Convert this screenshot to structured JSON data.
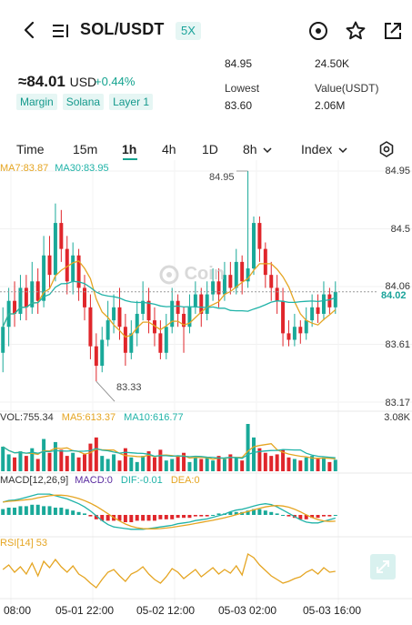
{
  "header": {
    "pair": "SOL/USDT",
    "leverage": "5X",
    "icons": [
      "back-icon",
      "list-icon",
      "target-icon",
      "star-icon",
      "share-icon"
    ]
  },
  "summary": {
    "price": "≈84.01",
    "price_unit": "USD",
    "change": "+0.44%",
    "tags": [
      "Margin",
      "Solana",
      "Layer 1"
    ],
    "high_value": "84.95",
    "vol_value": "24.50K",
    "lowest_label": "Lowest",
    "lowest_value": "83.60",
    "value_label": "Value(USDT)",
    "value_value": "2.06M"
  },
  "tabs": {
    "time": "Time",
    "m15": "15m",
    "h1": "1h",
    "h4": "4h",
    "d1": "1D",
    "h8": "8h",
    "index": "Index",
    "active": "1h"
  },
  "legend": {
    "ma7": "MA7:83.87",
    "ma30": "MA30:83.95",
    "vol": "VOL:755.34",
    "ma5": "MA5:613.37",
    "ma10": "MA10:616.77",
    "macd_params": "MACD[12,26,9]",
    "macd": "MACD:0",
    "dif": "DIF:-0.01",
    "dea": "DEA:0",
    "rsi": "RSI[14] 53"
  },
  "axis": {
    "p1": "84.95",
    "p2": "84.5",
    "p3": "84.06",
    "p4": "83.61",
    "p5": "83.17",
    "vol_max": "3.08K",
    "current": "84.02",
    "high_marker": "84.95",
    "low_marker": "83.33",
    "x": [
      "08:00",
      "05-01 22:00",
      "05-02 12:00",
      "05-03 02:00",
      "05-03 16:00"
    ]
  },
  "watermark": "Coin",
  "colors": {
    "up": "#19a999",
    "down": "#e0262b",
    "ma7": "#e5a522",
    "ma30": "#20b3a8",
    "macd_dif": "#20b3a8",
    "rsi": "#e5a522"
  },
  "chart_data": {
    "type": "candlestick",
    "timeframe": "1h",
    "y_range": [
      83.17,
      84.95
    ],
    "candles": [
      {
        "o": 83.55,
        "c": 83.75,
        "h": 83.9,
        "l": 83.4
      },
      {
        "o": 83.75,
        "c": 83.95,
        "h": 84.05,
        "l": 83.6
      },
      {
        "o": 83.95,
        "c": 83.85,
        "h": 84.1,
        "l": 83.75
      },
      {
        "o": 83.85,
        "c": 84.05,
        "h": 84.15,
        "l": 83.8
      },
      {
        "o": 84.05,
        "c": 83.9,
        "h": 84.15,
        "l": 83.8
      },
      {
        "o": 83.9,
        "c": 84.1,
        "h": 84.25,
        "l": 83.85
      },
      {
        "o": 84.1,
        "c": 83.95,
        "h": 84.2,
        "l": 83.85
      },
      {
        "o": 83.95,
        "c": 84.3,
        "h": 84.45,
        "l": 83.9
      },
      {
        "o": 84.3,
        "c": 84.15,
        "h": 84.45,
        "l": 84.05
      },
      {
        "o": 84.15,
        "c": 84.55,
        "h": 84.7,
        "l": 84.1
      },
      {
        "o": 84.55,
        "c": 84.35,
        "h": 84.65,
        "l": 84.25
      },
      {
        "o": 84.35,
        "c": 84.1,
        "h": 84.45,
        "l": 84.0
      },
      {
        "o": 84.1,
        "c": 84.3,
        "h": 84.4,
        "l": 84.0
      },
      {
        "o": 84.3,
        "c": 84.05,
        "h": 84.35,
        "l": 83.95
      },
      {
        "o": 84.05,
        "c": 83.9,
        "h": 84.15,
        "l": 83.8
      },
      {
        "o": 83.9,
        "c": 83.6,
        "h": 84.0,
        "l": 83.5
      },
      {
        "o": 83.6,
        "c": 83.45,
        "h": 83.7,
        "l": 83.33
      },
      {
        "o": 83.45,
        "c": 83.65,
        "h": 83.75,
        "l": 83.4
      },
      {
        "o": 83.65,
        "c": 83.8,
        "h": 83.95,
        "l": 83.6
      },
      {
        "o": 83.8,
        "c": 83.9,
        "h": 84.0,
        "l": 83.7
      },
      {
        "o": 83.9,
        "c": 83.75,
        "h": 84.05,
        "l": 83.65
      },
      {
        "o": 83.75,
        "c": 83.55,
        "h": 83.85,
        "l": 83.45
      },
      {
        "o": 83.55,
        "c": 83.7,
        "h": 83.8,
        "l": 83.5
      },
      {
        "o": 83.7,
        "c": 83.85,
        "h": 83.95,
        "l": 83.6
      },
      {
        "o": 83.85,
        "c": 83.95,
        "h": 84.1,
        "l": 83.8
      },
      {
        "o": 83.95,
        "c": 83.8,
        "h": 84.05,
        "l": 83.7
      },
      {
        "o": 83.8,
        "c": 83.7,
        "h": 83.9,
        "l": 83.6
      },
      {
        "o": 83.7,
        "c": 83.55,
        "h": 83.8,
        "l": 83.5
      },
      {
        "o": 83.55,
        "c": 83.75,
        "h": 83.85,
        "l": 83.5
      },
      {
        "o": 83.75,
        "c": 83.95,
        "h": 84.05,
        "l": 83.7
      },
      {
        "o": 83.95,
        "c": 83.85,
        "h": 84.0,
        "l": 83.75
      },
      {
        "o": 83.85,
        "c": 83.75,
        "h": 83.9,
        "l": 83.55
      },
      {
        "o": 83.75,
        "c": 83.9,
        "h": 84.0,
        "l": 83.7
      },
      {
        "o": 83.9,
        "c": 84.0,
        "h": 84.1,
        "l": 83.85
      },
      {
        "o": 84.0,
        "c": 83.85,
        "h": 84.05,
        "l": 83.75
      },
      {
        "o": 83.85,
        "c": 84.0,
        "h": 84.1,
        "l": 83.8
      },
      {
        "o": 84.0,
        "c": 84.1,
        "h": 84.2,
        "l": 83.95
      },
      {
        "o": 84.1,
        "c": 84.0,
        "h": 84.2,
        "l": 83.9
      },
      {
        "o": 84.0,
        "c": 84.15,
        "h": 84.25,
        "l": 83.95
      },
      {
        "o": 84.15,
        "c": 84.05,
        "h": 84.25,
        "l": 84.0
      },
      {
        "o": 84.05,
        "c": 84.25,
        "h": 84.35,
        "l": 84.0
      },
      {
        "o": 84.25,
        "c": 84.1,
        "h": 84.3,
        "l": 84.0
      },
      {
        "o": 84.1,
        "c": 84.2,
        "h": 84.95,
        "l": 84.05
      },
      {
        "o": 84.2,
        "c": 84.55,
        "h": 84.6,
        "l": 84.15
      },
      {
        "o": 84.55,
        "c": 84.35,
        "h": 84.6,
        "l": 84.25
      },
      {
        "o": 84.35,
        "c": 84.15,
        "h": 84.4,
        "l": 84.05
      },
      {
        "o": 84.15,
        "c": 84.05,
        "h": 84.25,
        "l": 83.95
      },
      {
        "o": 84.05,
        "c": 83.95,
        "h": 84.15,
        "l": 83.85
      },
      {
        "o": 83.95,
        "c": 83.7,
        "h": 84.05,
        "l": 83.6
      },
      {
        "o": 83.7,
        "c": 83.65,
        "h": 83.8,
        "l": 83.6
      },
      {
        "o": 83.65,
        "c": 83.75,
        "h": 83.85,
        "l": 83.6
      },
      {
        "o": 83.75,
        "c": 83.7,
        "h": 83.8,
        "l": 83.62
      },
      {
        "o": 83.7,
        "c": 83.8,
        "h": 83.9,
        "l": 83.65
      },
      {
        "o": 83.8,
        "c": 83.9,
        "h": 84.0,
        "l": 83.75
      },
      {
        "o": 83.9,
        "c": 83.85,
        "h": 84.0,
        "l": 83.78
      },
      {
        "o": 83.85,
        "c": 84.0,
        "h": 84.1,
        "l": 83.8
      },
      {
        "o": 84.0,
        "c": 83.9,
        "h": 84.05,
        "l": 83.85
      },
      {
        "o": 83.9,
        "c": 84.02,
        "h": 84.1,
        "l": 83.85
      }
    ],
    "volume": [
      1.6,
      1.1,
      0.9,
      1.3,
      1.0,
      1.5,
      0.8,
      2.1,
      1.2,
      1.9,
      1.4,
      1.0,
      1.2,
      0.9,
      1.1,
      1.8,
      2.2,
      1.0,
      0.8,
      1.1,
      0.7,
      1.5,
      0.9,
      0.6,
      1.0,
      1.3,
      0.9,
      1.4,
      0.7,
      0.8,
      1.0,
      1.2,
      0.6,
      0.9,
      0.8,
      0.9,
      0.7,
      1.0,
      0.8,
      1.1,
      0.9,
      0.7,
      3.08,
      2.2,
      1.5,
      1.2,
      1.0,
      1.1,
      1.4,
      0.9,
      0.8,
      0.7,
      0.9,
      1.0,
      0.8,
      0.9,
      0.6,
      0.75
    ],
    "macd_hist": [
      0.04,
      0.05,
      0.05,
      0.06,
      0.06,
      0.07,
      0.07,
      0.06,
      0.06,
      0.05,
      0.05,
      0.04,
      0.03,
      0.02,
      0.01,
      -0.01,
      -0.03,
      -0.04,
      -0.04,
      -0.04,
      -0.04,
      -0.05,
      -0.05,
      -0.04,
      -0.04,
      -0.04,
      -0.04,
      -0.03,
      -0.03,
      -0.03,
      -0.02,
      -0.02,
      -0.02,
      -0.01,
      -0.01,
      -0.01,
      0.0,
      0.01,
      0.01,
      0.02,
      0.02,
      0.02,
      0.03,
      0.04,
      0.04,
      0.03,
      0.02,
      0.01,
      0.0,
      -0.01,
      -0.02,
      -0.03,
      -0.03,
      -0.02,
      -0.02,
      -0.01,
      -0.01,
      0.0
    ],
    "rsi": [
      55,
      60,
      52,
      58,
      50,
      62,
      48,
      64,
      57,
      66,
      58,
      52,
      59,
      50,
      46,
      40,
      35,
      44,
      52,
      55,
      48,
      42,
      50,
      53,
      58,
      50,
      44,
      40,
      47,
      56,
      52,
      45,
      50,
      55,
      47,
      52,
      57,
      50,
      55,
      51,
      59,
      49,
      72,
      68,
      60,
      54,
      48,
      44,
      40,
      42,
      45,
      47,
      52,
      55,
      50,
      57,
      52,
      53
    ]
  }
}
